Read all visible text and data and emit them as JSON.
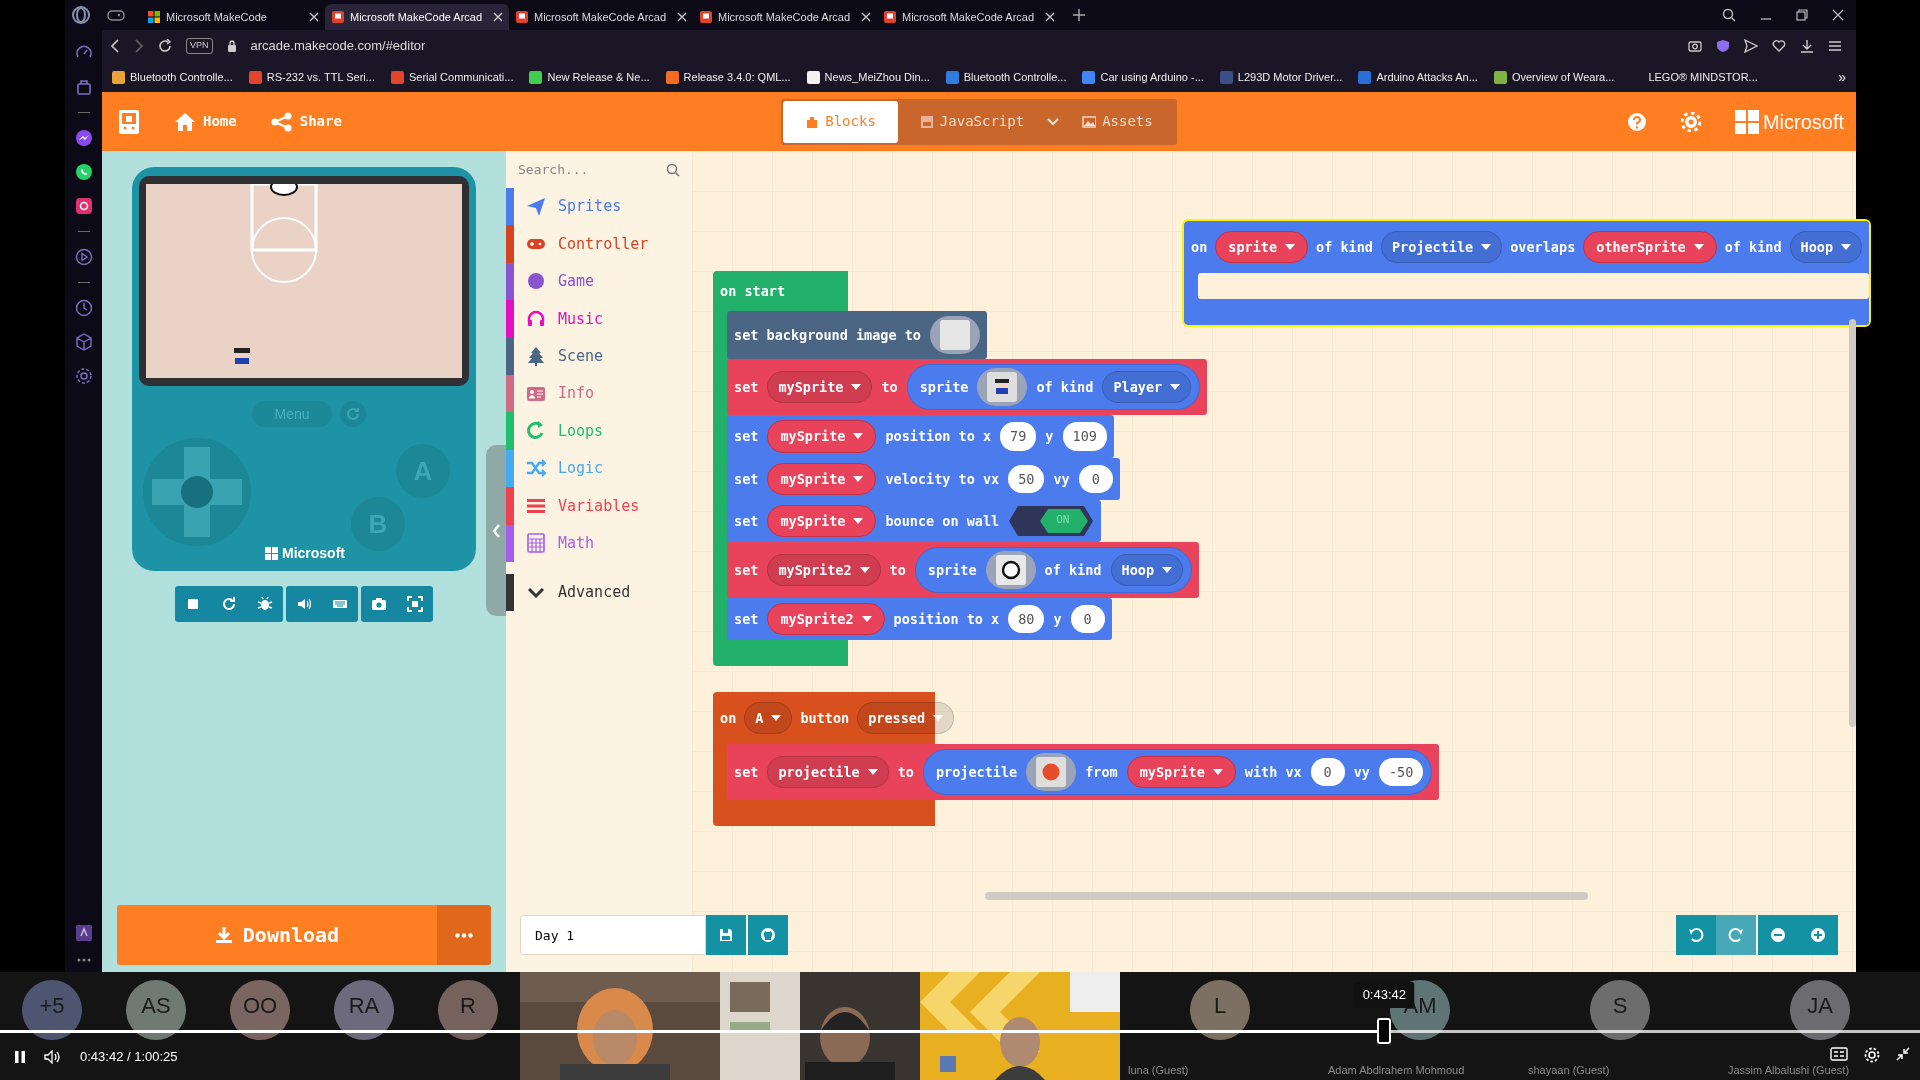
{
  "browser": {
    "tabs": [
      {
        "kind": "makecode",
        "title": "Microsoft MakeCode",
        "selected": false
      },
      {
        "kind": "arcade",
        "title": "Microsoft MakeCode Arcad",
        "selected": true
      },
      {
        "kind": "arcade",
        "title": "Microsoft MakeCode Arcad",
        "selected": false
      },
      {
        "kind": "arcade",
        "title": "Microsoft MakeCode Arcad",
        "selected": false
      },
      {
        "kind": "arcade",
        "title": "Microsoft MakeCode Arcad",
        "selected": false
      }
    ],
    "vpn": "VPN",
    "address": "arcade.makecode.com/#editor",
    "bookmarks": [
      {
        "title": "Bluetooth Controlle...",
        "color": "#e8a33a"
      },
      {
        "title": "RS-232 vs. TTL Seri...",
        "color": "#e2452b"
      },
      {
        "title": "Serial Communicati...",
        "color": "#e2452b"
      },
      {
        "title": "New Release & Ne...",
        "color": "#41cd52"
      },
      {
        "title": "Release 3.4.0: QML...",
        "color": "#f26b22"
      },
      {
        "title": "News_MeiZhou Din...",
        "color": "#f2f2f2"
      },
      {
        "title": "Bluetooth Controlle...",
        "color": "#2f7be0"
      },
      {
        "title": "Car using Arduino -...",
        "color": "#4285f4"
      },
      {
        "title": "L293D Motor Driver...",
        "color": "#3b4f86"
      },
      {
        "title": "Arduino Attacks An...",
        "color": "#2a6fd6"
      },
      {
        "title": "Overview of Weara...",
        "color": "#7cb342"
      },
      {
        "title": "LEGO® MINDSTOR..."
      }
    ],
    "more": "»"
  },
  "header": {
    "nav": [
      {
        "kind": "home",
        "label": "Home"
      },
      {
        "kind": "share",
        "label": "Share"
      }
    ],
    "editor_tabs": [
      {
        "kind": "blocks",
        "label": "Blocks",
        "selected": true
      },
      {
        "kind": "javascript",
        "label": "JavaScript",
        "selected": false
      },
      {
        "kind": "assets",
        "label": "Assets",
        "selected": false
      }
    ],
    "brand": "Microsoft"
  },
  "simulator": {
    "menu": "Menu",
    "a": "A",
    "b": "B",
    "brand": "Microsoft"
  },
  "download": "Download",
  "toolbox": {
    "placeholder": "Search...",
    "categories": [
      {
        "kind": "sprites",
        "label": "Sprites",
        "color": "#4b7bec"
      },
      {
        "kind": "controller",
        "label": "Controller",
        "color": "#d54322"
      },
      {
        "kind": "game",
        "label": "Game",
        "color": "#8854d0"
      },
      {
        "kind": "music",
        "label": "Music",
        "color": "#e30fc0"
      },
      {
        "kind": "scene",
        "label": "Scene",
        "color": "#4b6584"
      },
      {
        "kind": "info",
        "label": "Info",
        "color": "#cf6a87"
      },
      {
        "kind": "loops",
        "label": "Loops",
        "color": "#20bf6b"
      },
      {
        "kind": "logic",
        "label": "Logic",
        "color": "#45aaf2"
      },
      {
        "kind": "variables",
        "label": "Variables",
        "color": "#ee4250"
      },
      {
        "kind": "math",
        "label": "Math",
        "color": "#a55eea"
      },
      {
        "kind": "advanced",
        "label": "Advanced",
        "color": "#333333"
      }
    ]
  },
  "workspace": {
    "blocks": [
      {
        "color": "#4b7bec",
        "selected": true,
        "header": [
          {
            "kind": "word",
            "text": "on"
          },
          {
            "kind": "variable",
            "text": "sprite"
          },
          {
            "kind": "word",
            "text": "of kind"
          },
          {
            "kind": "dropdown",
            "text": "Projectile"
          },
          {
            "kind": "word",
            "text": "overlaps"
          },
          {
            "kind": "variable",
            "text": "otherSprite"
          },
          {
            "kind": "word",
            "text": "of kind"
          },
          {
            "kind": "dropdown",
            "text": "Hoop"
          }
        ]
      },
      {
        "color": "#23b06a",
        "selected": false,
        "header": [
          {
            "kind": "word",
            "text": "on start"
          }
        ],
        "body": [
          {
            "color": "#4b6584",
            "tokens": [
              {
                "kind": "word",
                "text": "set background image to"
              },
              {
                "kind": "blankimage"
              }
            ]
          },
          {
            "color": "#e8435a",
            "tokens": [
              {
                "kind": "word",
                "text": "set"
              },
              {
                "kind": "dropdown",
                "text": "mySprite"
              },
              {
                "kind": "word",
                "text": "to"
              },
              {
                "kind": "reporter",
                "tokens": [
                  {
                    "kind": "word",
                    "text": "sprite"
                  },
                  {
                    "kind": "figureimage"
                  },
                  {
                    "kind": "word",
                    "text": "of kind"
                  },
                  {
                    "kind": "dropdown",
                    "text": "Player"
                  }
                ]
              }
            ]
          },
          {
            "color": "#4b7bec",
            "tokens": [
              {
                "kind": "word",
                "text": "set"
              },
              {
                "kind": "variable",
                "text": "mySprite"
              },
              {
                "kind": "word",
                "text": "position to x"
              },
              {
                "kind": "number",
                "text": "79"
              },
              {
                "kind": "word",
                "text": "y"
              },
              {
                "kind": "number",
                "text": "109"
              }
            ]
          },
          {
            "color": "#4b7bec",
            "tokens": [
              {
                "kind": "word",
                "text": "set"
              },
              {
                "kind": "variable",
                "text": "mySprite"
              },
              {
                "kind": "word",
                "text": "velocity to vx"
              },
              {
                "kind": "number",
                "text": "50"
              },
              {
                "kind": "word",
                "text": "vy"
              },
              {
                "kind": "number",
                "text": "0"
              }
            ]
          },
          {
            "color": "#4b7bec",
            "tokens": [
              {
                "kind": "word",
                "text": "set"
              },
              {
                "kind": "variable",
                "text": "mySprite"
              },
              {
                "kind": "word",
                "text": "bounce on wall"
              },
              {
                "kind": "toggle",
                "text": "ON",
                "on": true
              }
            ]
          },
          {
            "color": "#e8435a",
            "tokens": [
              {
                "kind": "word",
                "text": "set"
              },
              {
                "kind": "dropdown",
                "text": "mySprite2"
              },
              {
                "kind": "word",
                "text": "to"
              },
              {
                "kind": "reporter",
                "tokens": [
                  {
                    "kind": "word",
                    "text": "sprite"
                  },
                  {
                    "kind": "ringimage"
                  },
                  {
                    "kind": "word",
                    "text": "of kind"
                  },
                  {
                    "kind": "dropdown",
                    "text": "Hoop"
                  }
                ]
              }
            ]
          },
          {
            "color": "#4b7bec",
            "tokens": [
              {
                "kind": "word",
                "text": "set"
              },
              {
                "kind": "variable",
                "text": "mySprite2"
              },
              {
                "kind": "word",
                "text": "position to x"
              },
              {
                "kind": "number",
                "text": "80"
              },
              {
                "kind": "word",
                "text": "y"
              },
              {
                "kind": "number",
                "text": "0"
              }
            ]
          }
        ]
      },
      {
        "color": "#d9501f",
        "selected": false,
        "header": [
          {
            "kind": "word",
            "text": "on"
          },
          {
            "kind": "dropdown",
            "text": "A"
          },
          {
            "kind": "word",
            "text": "button"
          },
          {
            "kind": "dropdown",
            "text": "pressed"
          }
        ],
        "body": [
          {
            "color": "#e8435a",
            "tokens": [
              {
                "kind": "word",
                "text": "set"
              },
              {
                "kind": "dropdown",
                "text": "projectile"
              },
              {
                "kind": "word",
                "text": "to"
              },
              {
                "kind": "reporter",
                "tokens": [
                  {
                    "kind": "word",
                    "text": "projectile"
                  },
                  {
                    "kind": "dotimage"
                  },
                  {
                    "kind": "word",
                    "text": "from"
                  },
                  {
                    "kind": "variable",
                    "text": "mySprite"
                  },
                  {
                    "kind": "word",
                    "text": "with vx"
                  },
                  {
                    "kind": "number",
                    "text": "0"
                  },
                  {
                    "kind": "word",
                    "text": "vy"
                  },
                  {
                    "kind": "number",
                    "text": "-50"
                  }
                ]
              }
            ]
          }
        ]
      }
    ]
  },
  "project_name": "Day 1",
  "video": {
    "participants": [
      {
        "kind": "avatar",
        "initials": "+5",
        "color": "#4d5570"
      },
      {
        "kind": "avatar",
        "initials": "AS",
        "color": "#6f7a72"
      },
      {
        "kind": "avatar",
        "initials": "OO",
        "color": "#7a6560"
      },
      {
        "kind": "avatar",
        "initials": "RA",
        "color": "#6c6a7c"
      },
      {
        "kind": "avatar",
        "initials": "R",
        "color": "#76625d"
      },
      {
        "kind": "video"
      },
      {
        "kind": "video"
      },
      {
        "kind": "video"
      },
      {
        "kind": "avatar",
        "initials": "L",
        "color": "#7c7062",
        "name": "luna (Guest)"
      },
      {
        "kind": "avatar",
        "initials": "AM",
        "color": "#5f7575",
        "name": "Adam Abdlrahem Mohmoud"
      },
      {
        "kind": "avatar",
        "initials": "S",
        "color": "#6d6d6d",
        "name": "shayaan (Guest)"
      },
      {
        "kind": "avatar",
        "initials": "JA",
        "color": "#6c6c70",
        "name": "Jassim Albalushi (Guest)"
      }
    ],
    "tooltip": "0:43:42",
    "time": "0:43:42 / 1:00:25",
    "level": 0.721
  }
}
